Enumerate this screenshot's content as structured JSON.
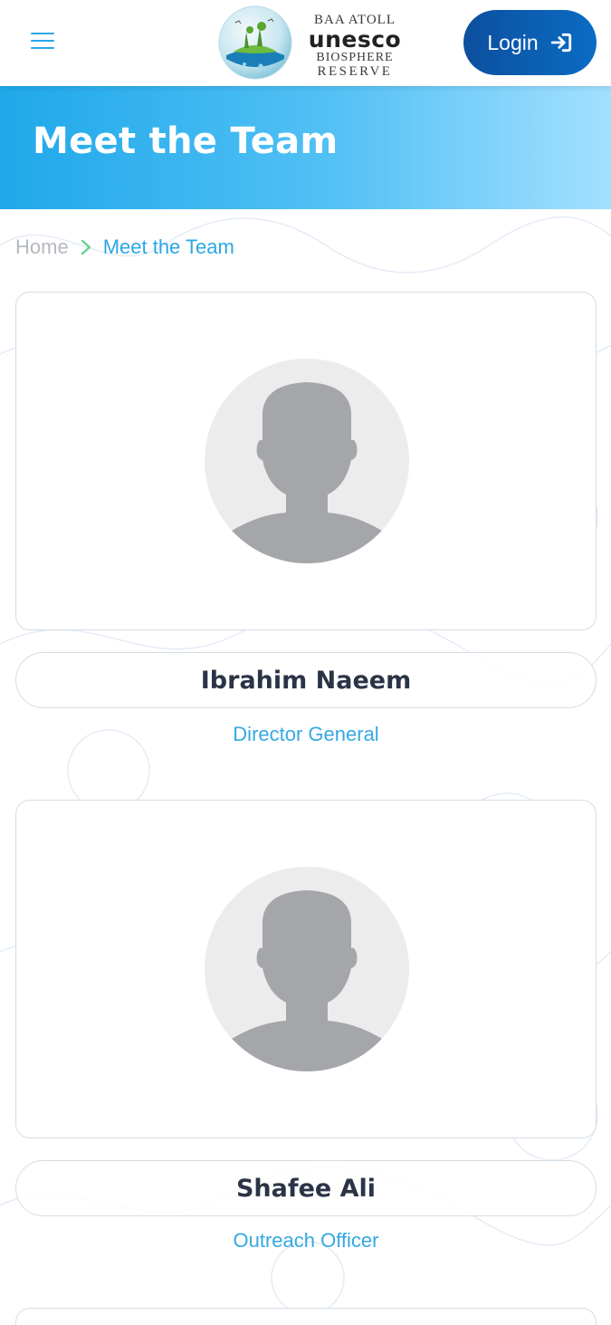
{
  "header": {
    "menu_icon": "hamburger-menu-icon",
    "logo": {
      "line1": "BAA ATOLL",
      "line2": "unesco",
      "line3": "BIOSPHERE",
      "line4": "RESERVE"
    },
    "login_label": "Login",
    "login_icon": "sign-in-arrow-icon"
  },
  "banner": {
    "title": "Meet the Team"
  },
  "breadcrumb": {
    "home": "Home",
    "separator_icon": "chevron-right-icon",
    "current": "Meet the Team"
  },
  "team": [
    {
      "name": "Ibrahim Naeem",
      "role": "Director General",
      "photo": "placeholder-avatar"
    },
    {
      "name": "Shafee Ali",
      "role": "Outreach Officer",
      "photo": "placeholder-avatar"
    }
  ],
  "colors": {
    "accent": "#2aa7e6",
    "login_button": "#0a5cb0",
    "banner_start": "#1fa8ea",
    "banner_end": "#a3e0ff",
    "name_text": "#2b3446",
    "breadcrumb_separator": "#5ed48a"
  }
}
